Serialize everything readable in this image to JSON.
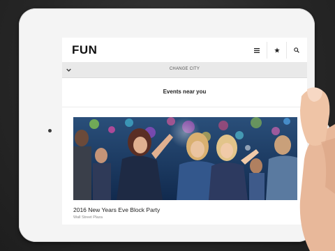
{
  "app": {
    "logo": "FUN"
  },
  "header": {
    "menu_icon": "menu-icon",
    "favorites_icon": "star-icon",
    "search_icon": "search-icon"
  },
  "city_bar": {
    "toggle_icon": "chevron-down-icon",
    "label": "CHANGE CITY"
  },
  "main": {
    "section_title": "Events near you",
    "events": [
      {
        "title": "2016 New Years Eve Block Party",
        "venue": "Wall Street Plaza"
      }
    ]
  },
  "colors": {
    "background": "#262626",
    "screen": "#ffffff",
    "city_bar": "#e9e9e9"
  }
}
